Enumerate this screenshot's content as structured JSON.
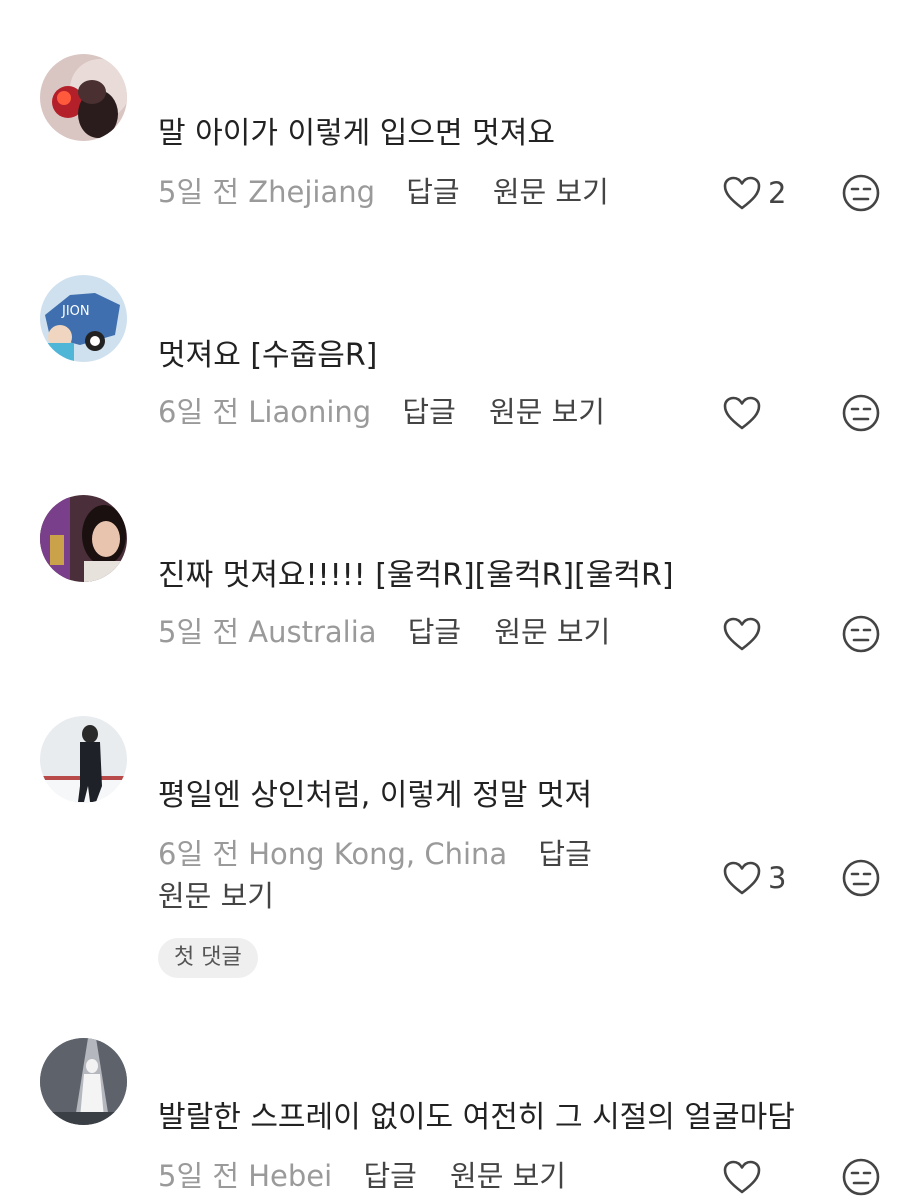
{
  "comments": [
    {
      "text": "말 아이가 이렇게 입으면 멋져요",
      "age": "5일 전",
      "location": "Zhejiang",
      "reply": "답글",
      "translate": "원문 보기",
      "likes": "2"
    },
    {
      "text": "멋져요 [수줍음R]",
      "age": "6일 전",
      "location": "Liaoning",
      "reply": "답글",
      "translate": "원문 보기",
      "likes": ""
    },
    {
      "text": "진짜 멋져요!!!!! [울컥R][울컥R][울컥R]",
      "age": "5일 전",
      "location": "Australia",
      "reply": "답글",
      "translate": "원문 보기",
      "likes": ""
    },
    {
      "text": "평일엔 상인처럼, 이렇게 정말 멋져",
      "age": "6일 전",
      "location": "Hong Kong, China",
      "reply": "답글",
      "translate": "원문 보기",
      "likes": "3",
      "badge": "첫 댓글"
    },
    {
      "text": "발랄한 스프레이 없이도 여전히 그 시절의 얼굴마담",
      "age": "5일 전",
      "location": "Hebei",
      "reply": "답글",
      "translate": "원문 보기",
      "likes": ""
    }
  ],
  "icons": {
    "like": "heart-outline-icon",
    "dislike": "neutral-face-icon"
  },
  "colors": {
    "text": "#222222",
    "meta": "#9a9a9a",
    "action": "#444444",
    "badge_bg": "#efefef"
  }
}
